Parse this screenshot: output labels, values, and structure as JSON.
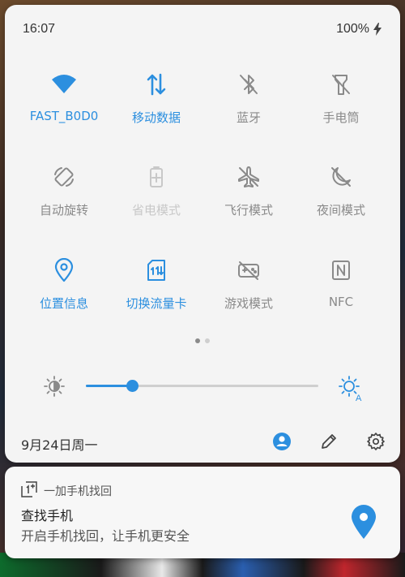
{
  "status": {
    "time": "16:07",
    "battery": "100%"
  },
  "tiles": [
    {
      "label": "FAST_B0D0",
      "icon": "wifi-icon",
      "state": "on"
    },
    {
      "label": "移动数据",
      "icon": "mobile-data-icon",
      "state": "on"
    },
    {
      "label": "蓝牙",
      "icon": "bluetooth-off-icon",
      "state": "off"
    },
    {
      "label": "手电筒",
      "icon": "flashlight-off-icon",
      "state": "off"
    },
    {
      "label": "自动旋转",
      "icon": "auto-rotate-icon",
      "state": "off"
    },
    {
      "label": "省电模式",
      "icon": "battery-saver-icon",
      "state": "disabled"
    },
    {
      "label": "飞行模式",
      "icon": "airplane-off-icon",
      "state": "off"
    },
    {
      "label": "夜间模式",
      "icon": "night-mode-off-icon",
      "state": "off"
    },
    {
      "label": "位置信息",
      "icon": "location-icon",
      "state": "on"
    },
    {
      "label": "切换流量卡",
      "icon": "sim-switch-icon",
      "state": "on"
    },
    {
      "label": "游戏模式",
      "icon": "game-mode-off-icon",
      "state": "off"
    },
    {
      "label": "NFC",
      "icon": "nfc-icon",
      "state": "off"
    }
  ],
  "page_dots": {
    "current": 1,
    "total": 2
  },
  "brightness": {
    "level": 0.2,
    "auto_label": "A"
  },
  "footer": {
    "date": "9月24日周一"
  },
  "notification": {
    "app": "一加手机找回",
    "title": "查找手机",
    "body": "开启手机找回，让手机更安全"
  },
  "colors": {
    "accent": "#2c8fdf",
    "inactive": "#8a8a8a",
    "disabled": "#c8c8c8",
    "panel": "#f4f4f4"
  }
}
